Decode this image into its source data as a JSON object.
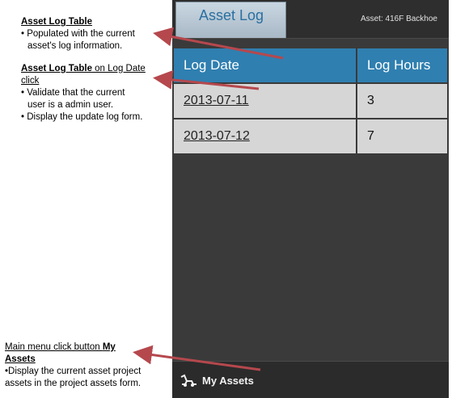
{
  "notes": {
    "n1": {
      "title": "Asset Log Table",
      "lines": [
        "• Populated with the current",
        "asset's log information."
      ]
    },
    "n2": {
      "title_a": "Asset Log Table",
      "title_b": " on Log Date",
      "title_c": "click",
      "lines": [
        "•  Validate that the current",
        "user is a admin user.",
        "• Display the update log form."
      ]
    },
    "n3": {
      "title_a": "Main menu  click button ",
      "title_b": "My",
      "title_c": "Assets",
      "lines": [
        "•Display the current asset project",
        "assets in the project assets  form."
      ]
    }
  },
  "app": {
    "tab_label": "Asset Log",
    "asset_info": "Asset: 416F Backhoe",
    "table": {
      "headers": [
        "Log Date",
        "Log Hours"
      ],
      "rows": [
        {
          "date": "2013-07-11",
          "hours": "3"
        },
        {
          "date": "2013-07-12",
          "hours": "7"
        }
      ]
    },
    "bottom_button": "My Assets",
    "icons": {
      "bottom_button": "excavator-icon"
    },
    "colors": {
      "header": "#2f7fb0",
      "tab_text": "#2a6fa0",
      "arrow": "#b5484d"
    }
  }
}
